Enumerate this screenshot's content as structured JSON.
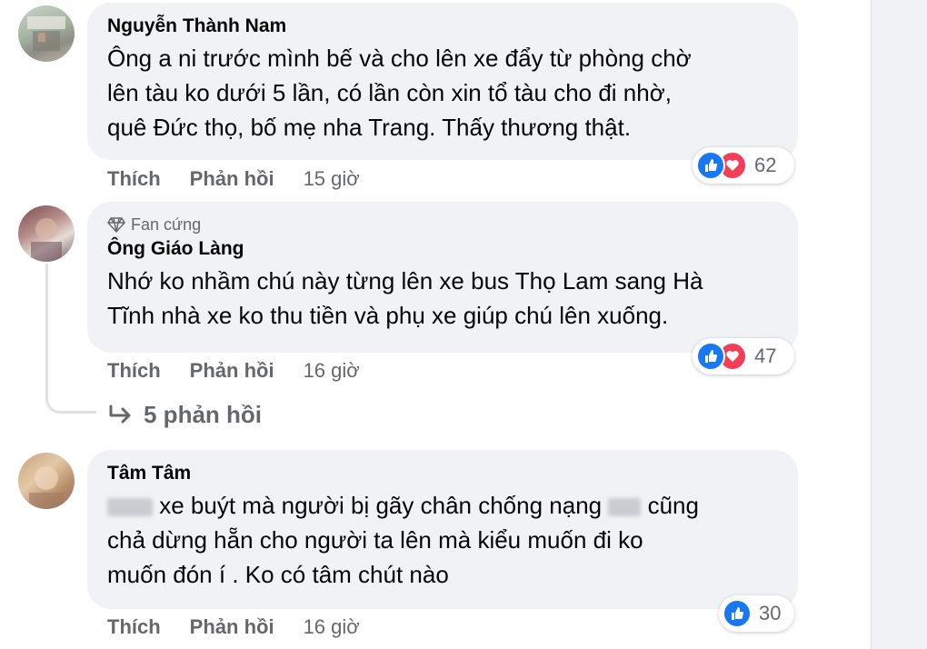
{
  "comments": [
    {
      "author": "Nguyễn Thành Nam",
      "lines": [
        "Ông a ni trước mình bế và cho lên xe đẩy từ phòng chờ",
        "lên tàu ko dưới 5 lần, có lần còn xin tổ tàu cho đi nhờ,",
        "quê Đức thọ, bố mẹ nha Trang. Thấy thương thật."
      ],
      "like_label": "Thích",
      "reply_label": "Phản hồi",
      "time": "15 giờ",
      "reaction_count": "62",
      "reactions": [
        "like-icon",
        "love-icon"
      ]
    },
    {
      "badge": "Fan cứng",
      "author": "Ông Giáo Làng",
      "lines": [
        "Nhớ ko nhầm chú này từng lên xe bus Thọ Lam sang Hà",
        "Tĩnh nhà xe ko thu tiền và phụ xe giúp chú lên xuống."
      ],
      "like_label": "Thích",
      "reply_label": "Phản hồi",
      "time": "16 giờ",
      "reaction_count": "47",
      "reactions": [
        "like-icon",
        "love-icon"
      ],
      "replies_label": "5 phản hồi"
    },
    {
      "author": "Tâm Tâm",
      "line1": "xe buýt mà người bị gãy chân chống nạng",
      "line1_end": "cũng",
      "lines_rest": [
        "chả dừng hẵn cho người ta lên mà kiểu muốn đi ko",
        "muốn đón í . Ko có tâm chút nào"
      ],
      "like_label": "Thích",
      "reply_label": "Phản hồi",
      "time": "16 giờ",
      "reaction_count": "30",
      "reactions": [
        "like-icon"
      ]
    }
  ],
  "colors": {
    "bubble": "#f0f2f5",
    "secondary_text": "#65676b",
    "like": "#1877f2",
    "love": "#f33e58"
  }
}
